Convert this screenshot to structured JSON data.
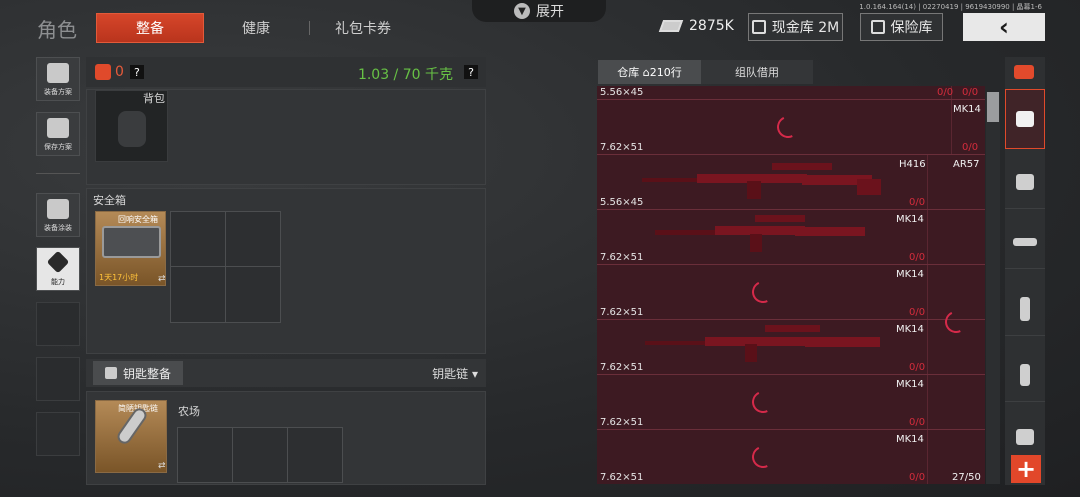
{
  "header": {
    "title": "角色",
    "tabs": [
      "整备",
      "健康",
      "礼包卡券"
    ],
    "expand_label": "展开",
    "version": "1.0.164.164(14) | 02270419 | 9619430990 | 晶幕1-6",
    "money": "2875K",
    "cash_vault": "现金库 2M",
    "insurance": "保险库"
  },
  "sidebar": {
    "items": [
      {
        "label": "装备方案",
        "icon": "vest-icon"
      },
      {
        "label": "保存方案",
        "icon": "download-icon"
      },
      {
        "label": "装备涂装",
        "icon": "helmet-icon"
      },
      {
        "label": "能力",
        "icon": "ability-icon"
      }
    ]
  },
  "loadout": {
    "count": "0",
    "help": "?",
    "weight": "1.03 / 70 千克",
    "backpack_label": "背包",
    "safe_section": "安全箱",
    "safe_name": "回响安全箱",
    "safe_timer": "1天17小时",
    "key_button": "钥匙整备",
    "key_chain": "钥匙链",
    "key_item_name": "简陋钥匙链",
    "farm_label": "农场"
  },
  "storage": {
    "tabs": [
      "仓库",
      "组队借用"
    ],
    "rows_count": "210行",
    "rows": [
      {
        "caliber": "5.56×45",
        "ammo": "0/0",
        "ammo2": "0/0",
        "name": "",
        "name2": ""
      },
      {
        "caliber": "7.62×51",
        "ammo": "",
        "ammo2": "0/0",
        "name": "",
        "name2": "MK14"
      },
      {
        "caliber": "5.56×45",
        "ammo": "0/0",
        "ammo2": "",
        "name": "H416",
        "name2": "AR57"
      },
      {
        "caliber": "7.62×51",
        "ammo": "0/0",
        "ammo2": "",
        "name": "MK14",
        "name2": ""
      },
      {
        "caliber": "7.62×51",
        "ammo": "0/0",
        "ammo2": "",
        "name": "MK14",
        "name2": ""
      },
      {
        "caliber": "7.62×51",
        "ammo": "0/0",
        "ammo2": "",
        "name": "MK14",
        "name2": ""
      },
      {
        "caliber": "7.62×51",
        "ammo": "0/0",
        "ammo2": "",
        "name": "MK14",
        "name2": ""
      },
      {
        "caliber": "7.62×51",
        "ammo": "0/0",
        "ammo2": "27/50",
        "name": "MK14",
        "name2": ""
      }
    ]
  },
  "categories": [
    "layers-icon",
    "stack-icon",
    "backpack-icon",
    "rifle-icon",
    "magazine-icon",
    "ammo-icon",
    "armor-icon"
  ],
  "plus": "+"
}
